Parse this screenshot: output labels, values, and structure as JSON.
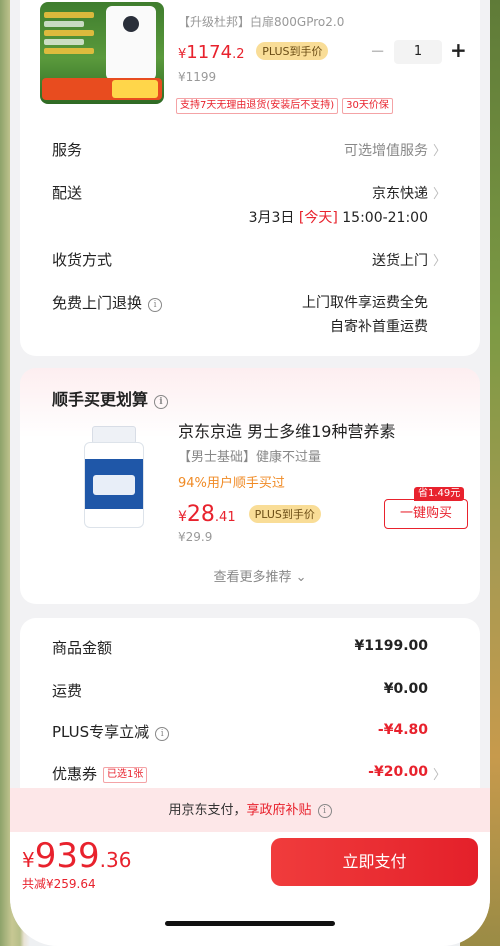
{
  "product": {
    "sku_text": "【升级杜邦】白扉800GPro2.0",
    "price_yen": "¥",
    "price_int": "1174",
    "price_dec": ".2",
    "plus_label": "PLUS到手价",
    "original_price": "¥1199",
    "quantity": "1",
    "minus_label": "−",
    "plus_btn_label": "+",
    "pills": [
      "支持7天无理由退货(安装后不支持)",
      "30天价保"
    ]
  },
  "service": {
    "label": "服务",
    "value": "可选增值服务"
  },
  "delivery": {
    "label": "配送",
    "carrier": "京东快递",
    "date": "3月3日",
    "today": "[今天]",
    "time": "15:00-21:00"
  },
  "receive": {
    "label": "收货方式",
    "value": "送货上门"
  },
  "free_return": {
    "label": "免费上门退换",
    "line1": "上门取件享运费全免",
    "line2": "自寄补首重运费"
  },
  "recommend": {
    "title": "顺手买更划算",
    "item": {
      "name": "京东京造 男士多维19种营养素",
      "subtitle": "【男士基础】健康不过量",
      "percent": "94%用户顺手买过",
      "price_yen": "¥",
      "price_int": "28",
      "price_dec": ".41",
      "plus_label": "PLUS到手价",
      "original_price": "¥29.9",
      "save_tag": "省1.49元",
      "buy_label": "一键购买"
    },
    "more_label": "查看更多推荐 ⌄"
  },
  "summary": {
    "rows": [
      {
        "label": "商品金额",
        "value": "¥1199.00"
      },
      {
        "label": "运费",
        "value": "¥0.00"
      },
      {
        "label": "PLUS专享立减",
        "value": "-¥4.80"
      },
      {
        "label": "优惠券",
        "badge": "已选1张",
        "value": "-¥20.00"
      }
    ]
  },
  "subsidy": {
    "prefix": "用京东支付，",
    "link": "享政府补贴"
  },
  "footer": {
    "yen": "¥",
    "total_int": "939",
    "total_dec": ".36",
    "reduced": "共减¥259.64",
    "pay_label": "立即支付"
  },
  "icons": {
    "chevron": "〉",
    "info": "i"
  },
  "colors": {
    "accent_red": "#e8222d",
    "plus_gold": "#f9dd97",
    "subsidy_bg": "#fde7e8"
  }
}
